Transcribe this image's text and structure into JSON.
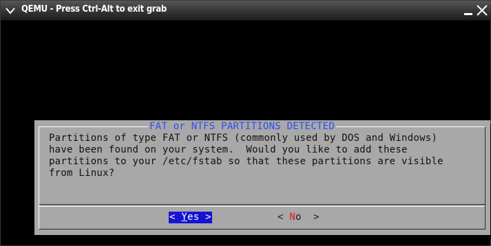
{
  "window": {
    "title": "QEMU - Press Ctrl-Alt to exit grab"
  },
  "dialog": {
    "title": "FAT or NTFS PARTITIONS DETECTED",
    "body_lines": [
      "Partitions of type FAT or NTFS (commonly used by DOS and Windows)",
      "have been found on your system.  Would you like to add these",
      "partitions to your /etc/fstab so that these partitions are visible",
      "from Linux?"
    ],
    "buttons": {
      "yes": {
        "open": "< ",
        "hotkey": "Y",
        "rest": "es",
        "close": " >"
      },
      "no": {
        "open": "< ",
        "hotkey": "N",
        "rest": "o",
        "close": "  >"
      }
    },
    "selected_button": "yes"
  },
  "colors": {
    "dialog_bg": "#a8a8a8",
    "title_text": "#2c4ff2",
    "selected_button": "#1414d2",
    "hotkey_red": "#e41818"
  },
  "icons": {
    "window_menu": "chevron-down-icon",
    "minimize": "minimize-icon",
    "close": "close-icon"
  }
}
